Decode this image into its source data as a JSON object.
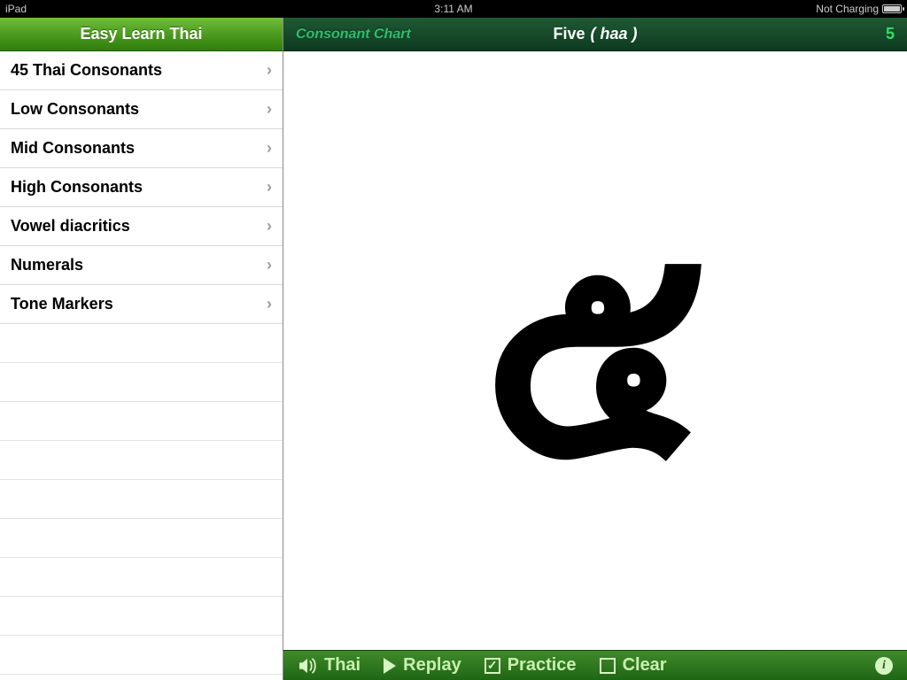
{
  "status": {
    "left": "iPad",
    "center": "3:11 AM",
    "right": "Not Charging"
  },
  "sidebar": {
    "title": "Easy Learn Thai",
    "items": [
      {
        "label": "45 Thai Consonants"
      },
      {
        "label": "Low Consonants"
      },
      {
        "label": "Mid Consonants"
      },
      {
        "label": "High Consonants"
      },
      {
        "label": "Vowel diacritics"
      },
      {
        "label": "Numerals"
      },
      {
        "label": "Tone Markers"
      }
    ]
  },
  "main": {
    "left_crumb": "Consonant Chart",
    "title_word": "Five",
    "title_roman": "( haa )",
    "index": "5",
    "glyph": "๕"
  },
  "toolbar": {
    "thai": "Thai",
    "replay": "Replay",
    "practice": "Practice",
    "clear": "Clear"
  }
}
